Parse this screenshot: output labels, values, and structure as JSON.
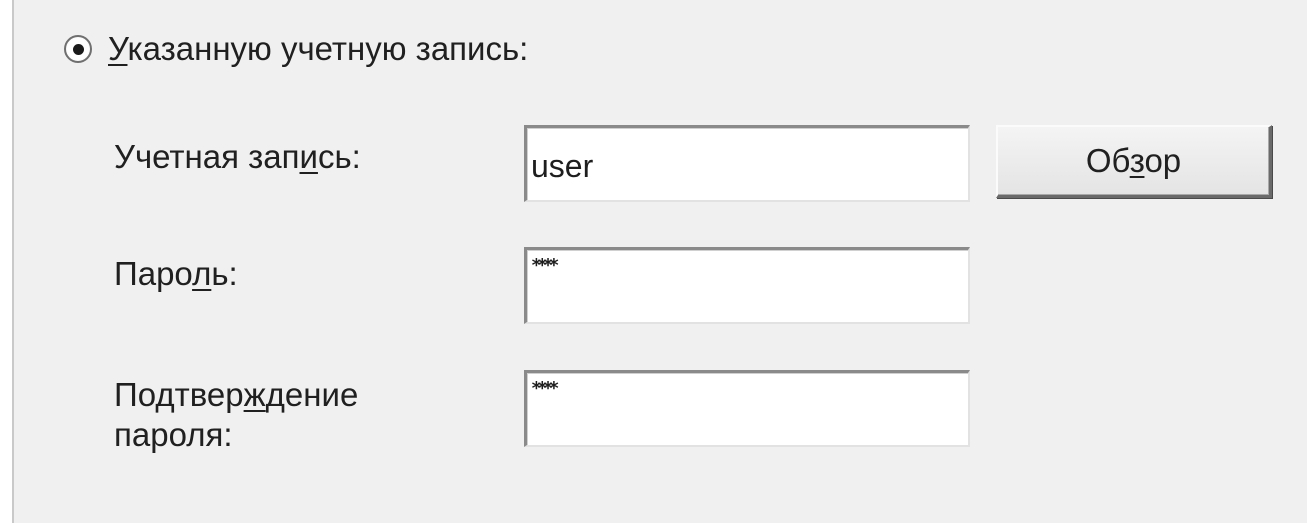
{
  "account_option": {
    "label_before": "",
    "mnemonic": "У",
    "label_after": "казанную учетную запись:",
    "selected": true
  },
  "fields": {
    "account": {
      "label_before": "Учетная зап",
      "mnemonic": "и",
      "label_after": "сь:",
      "value": "user"
    },
    "password": {
      "label_before": "Паро",
      "mnemonic": "л",
      "label_after": "ь:",
      "value": "****"
    },
    "confirm": {
      "label_line1_before": "Подтвер",
      "label_line1_mnemonic": "ж",
      "label_line1_after": "дение",
      "label_line2": "пароля:",
      "value": "****"
    }
  },
  "browse_button": {
    "label_before": "Об",
    "mnemonic": "з",
    "label_after": "ор"
  }
}
